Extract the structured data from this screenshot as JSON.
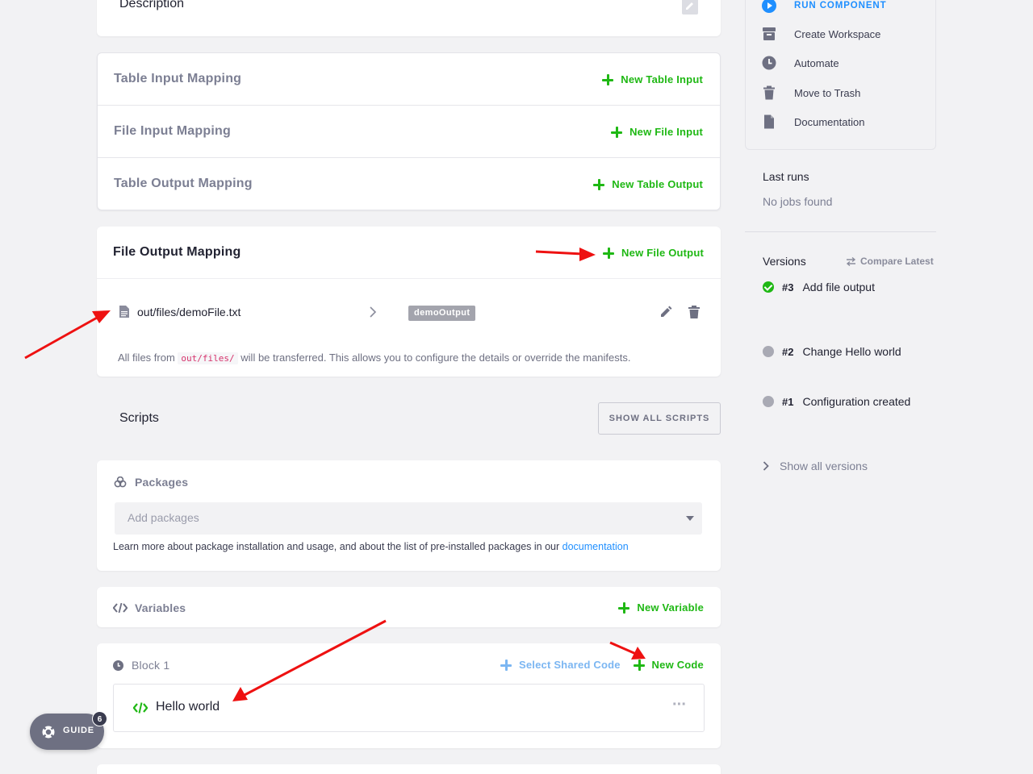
{
  "description": {
    "title": "Description"
  },
  "mappings": [
    {
      "title": "Table Input Mapping",
      "action": "New Table Input"
    },
    {
      "title": "File Input Mapping",
      "action": "New File Input"
    },
    {
      "title": "Table Output Mapping",
      "action": "New Table Output"
    }
  ],
  "file_output": {
    "title": "File Output Mapping",
    "action": "New File Output",
    "file_path": "out/files/demoFile.txt",
    "tag": "demoOutput",
    "note_before": "All files from",
    "note_code": "out/files/",
    "note_after": "will be transferred. This allows you to configure the details or override the manifests."
  },
  "scripts": {
    "title": "Scripts",
    "show_all_button": "SHOW ALL SCRIPTS"
  },
  "packages": {
    "title": "Packages",
    "placeholder": "Add packages",
    "help_text": "Learn more about package installation and usage, and about the list of pre-installed packages in our",
    "help_link": "documentation"
  },
  "variables": {
    "title": "Variables",
    "action": "New Variable"
  },
  "block": {
    "title": "Block 1",
    "select_shared": "Select Shared Code",
    "new_code": "New Code",
    "code_name": "Hello world",
    "more": "···"
  },
  "guide": {
    "label": "GUIDE",
    "count": "6"
  },
  "sidebar": {
    "actions": [
      {
        "label": "RUN COMPONENT",
        "icon": "play-icon"
      },
      {
        "label": "Create Workspace",
        "icon": "box-icon"
      },
      {
        "label": "Automate",
        "icon": "clock-icon"
      },
      {
        "label": "Move to Trash",
        "icon": "trash-icon"
      },
      {
        "label": "Documentation",
        "icon": "file-icon"
      }
    ],
    "last_runs": {
      "title": "Last runs",
      "empty": "No jobs found"
    },
    "versions": {
      "title": "Versions",
      "compare": "Compare Latest",
      "items": [
        {
          "num": "#3",
          "label": "Add file output",
          "status": "success"
        },
        {
          "num": "#2",
          "label": "Change Hello world",
          "status": "neutral"
        },
        {
          "num": "#1",
          "label": "Configuration created",
          "status": "neutral"
        }
      ],
      "show_all": "Show all versions"
    }
  },
  "colors": {
    "accent_green": "#1fb814",
    "link_blue": "#1f8fff",
    "run_blue": "#1f8fff"
  }
}
